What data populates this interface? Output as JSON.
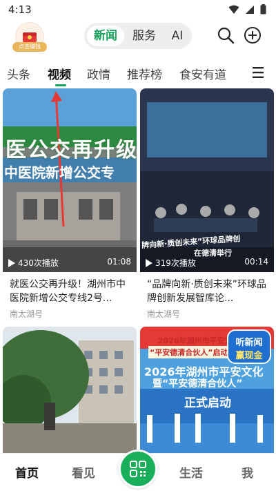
{
  "status_bar": {
    "time": "4:13"
  },
  "header": {
    "reward_label": "点击赚钱",
    "tabs": [
      {
        "label": "新闻",
        "active": true
      },
      {
        "label": "服务",
        "active": false
      },
      {
        "label": "AI",
        "active": false
      }
    ],
    "accent_color": "#1aa35b"
  },
  "channels": {
    "items": [
      {
        "label": "头条",
        "active": false
      },
      {
        "label": "视频",
        "active": true
      },
      {
        "label": "政情",
        "active": false
      },
      {
        "label": "推荐榜",
        "active": false
      },
      {
        "label": "食安有道",
        "active": false
      }
    ]
  },
  "feed": {
    "cards": [
      {
        "thumb_text_1": "医公交再升级",
        "thumb_text_2": "中医院新增公交专",
        "play_count": "430次播放",
        "duration": "01:08",
        "title": "就医公交再升级！湖州市中医院新增公交专线2号...",
        "source": "南太湖号"
      },
      {
        "thumb_text_1": "牌向新·质创未来”环球品牌创",
        "thumb_text_2": "在德清举行",
        "play_count": "319次播放",
        "duration": "00:14",
        "title": "“品牌向新·质创未来”环球品牌创新发展智库论...",
        "source": "南太湖号"
      },
      {
        "thumb_text_1": "",
        "thumb_text_2": "",
        "play_count": "",
        "duration": "",
        "title": "",
        "source": ""
      },
      {
        "thumb_text_1": "2026年湖州市平安文化",
        "thumb_text_2": "“平安德清合伙人”启动仪式举行",
        "thumb_text_3": "2026年湖州市平安文化",
        "thumb_text_4": "暨“平安德清合伙人”",
        "thumb_text_5": "正式启动",
        "promo_1": "听新闻",
        "promo_2": "赢现金",
        "play_count": "",
        "duration": "",
        "title": "",
        "source": ""
      }
    ]
  },
  "bottom_nav": {
    "items": [
      {
        "label": "首页",
        "active": true
      },
      {
        "label": "看见",
        "active": false
      },
      {
        "label": "生活",
        "active": false
      },
      {
        "label": "我",
        "active": false
      }
    ]
  }
}
